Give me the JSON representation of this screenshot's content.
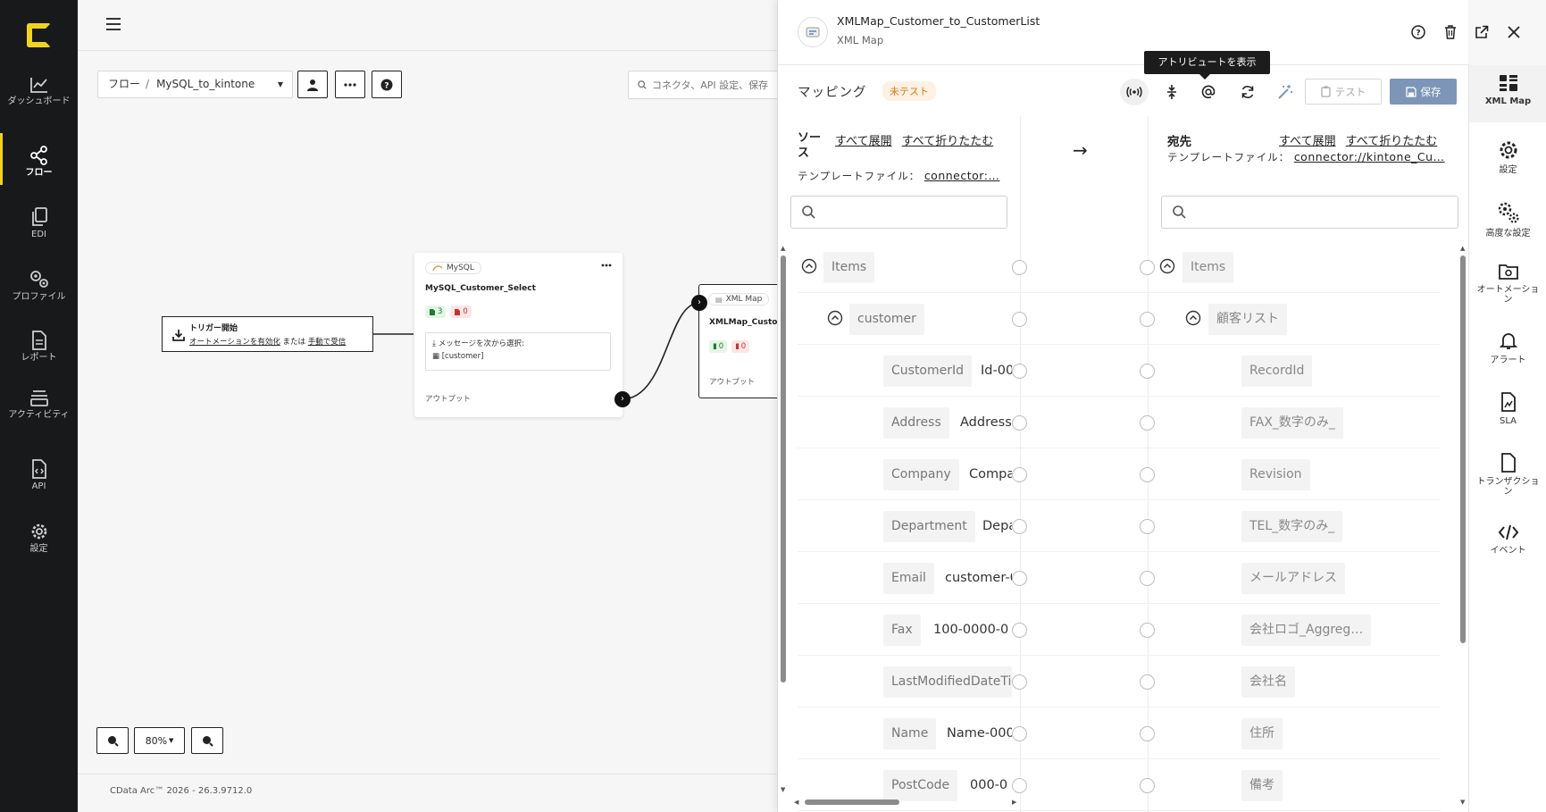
{
  "colors": {
    "nav_bg": "#18191b",
    "brand_yellow": "#f2d31b",
    "save_blue": "#7d96b8",
    "untested_orange": "#d57a1a"
  },
  "leftnav": {
    "items": [
      {
        "label": "ダッシュボード",
        "icon": "dashboard-chart-icon"
      },
      {
        "label": "フロー",
        "icon": "flow-share-icon",
        "active": true
      },
      {
        "label": "EDI",
        "icon": "edi-documents-icon"
      },
      {
        "label": "プロファイル",
        "icon": "profile-gears-icon"
      },
      {
        "label": "レポート",
        "icon": "report-document-icon"
      },
      {
        "label": "アクティビティ",
        "icon": "activity-stack-icon"
      },
      {
        "label": "API",
        "icon": "api-document-icon"
      },
      {
        "label": "設定",
        "icon": "settings-gear-icon"
      }
    ]
  },
  "canvas": {
    "breadcrumb": {
      "root": "フロー",
      "current": "MySQL_to_kintone"
    },
    "search_placeholder": "コネクタ、API 設定、保存",
    "zoom_level": "80%",
    "footer": "CData Arc™ 2026 - 26.3.9712.0",
    "trigger": {
      "title": "トリガー開始",
      "link_automation": "オートメーションを有効化",
      "or_text": "または",
      "link_manual": "手動で受信"
    },
    "mysql_node": {
      "type": "MySQL",
      "name": "MySQL_Customer_Select",
      "success_count": "3",
      "error_count": "0",
      "message_label": "メッセージを次から選択:",
      "message_value": "[customer]",
      "output_label": "アウトプット"
    },
    "xmlmap_node": {
      "type": "XML Map",
      "name": "XMLMap_Customer_to_CustomerList",
      "success_count": "0",
      "error_count": "0",
      "output_label": "アウトプット"
    }
  },
  "panel": {
    "title": "XMLMap_Customer_to_CustomerList",
    "subtitle": "XML Map",
    "mapping_title": "マッピング",
    "status_badge": "未テスト",
    "tooltip": "アトリビュートを表示",
    "test_label": "テスト",
    "save_label": "保存",
    "source": {
      "label": "ソース",
      "expand_all": "すべて展開",
      "collapse_all": "すべて折りたたむ",
      "template_label": "テンプレートファイル：",
      "template_link": "connector:…"
    },
    "arrow": "→",
    "dest": {
      "label": "宛先",
      "expand_all": "すべて展開",
      "collapse_all": "すべて折りたたむ",
      "template_label": "テンプレートファイル：",
      "template_link": "connector://kintone_Cu…"
    },
    "source_rows": [
      {
        "name": "Items",
        "value": ""
      },
      {
        "name": "customer",
        "value": ""
      },
      {
        "name": "CustomerId",
        "value": "Id-00"
      },
      {
        "name": "Address",
        "value": "Address-"
      },
      {
        "name": "Company",
        "value": "Compa"
      },
      {
        "name": "Department",
        "value": "Depa"
      },
      {
        "name": "Email",
        "value": "customer-0"
      },
      {
        "name": "Fax",
        "value": "100-0000-0"
      },
      {
        "name": "LastModifiedDateTime",
        "value": ""
      },
      {
        "name": "Name",
        "value": "Name-000"
      },
      {
        "name": "PostCode",
        "value": "000-0"
      }
    ],
    "dest_rows": [
      {
        "name": "Items"
      },
      {
        "name": "顧客リスト"
      },
      {
        "name": "RecordId"
      },
      {
        "name": "FAX_数字のみ_"
      },
      {
        "name": "Revision"
      },
      {
        "name": "TEL_数字のみ_"
      },
      {
        "name": "メールアドレス"
      },
      {
        "name": "会社ロゴ_Aggreg…"
      },
      {
        "name": "会社名"
      },
      {
        "name": "住所"
      },
      {
        "name": "備考"
      }
    ]
  },
  "rightbar": {
    "items": [
      {
        "label": "XML Map",
        "icon": "xml-map-grid-icon",
        "active": true
      },
      {
        "label": "設定",
        "icon": "settings-gear-icon"
      },
      {
        "label": "高度な設定",
        "icon": "advanced-gears-icon"
      },
      {
        "label": "オートメーション",
        "icon": "automation-folder-icon"
      },
      {
        "label": "アラート",
        "icon": "alert-bell-icon"
      },
      {
        "label": "SLA",
        "icon": "sla-document-icon"
      },
      {
        "label": "トランザクション",
        "icon": "transaction-document-icon"
      },
      {
        "label": "イベント",
        "icon": "event-code-icon"
      }
    ]
  }
}
